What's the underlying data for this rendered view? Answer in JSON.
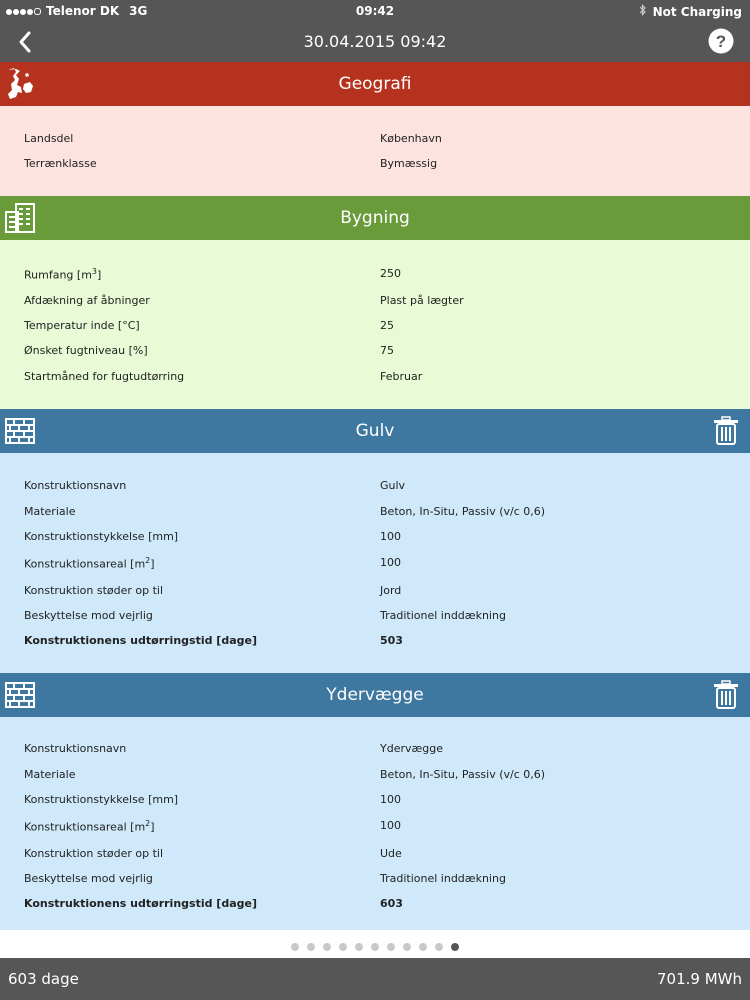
{
  "status_bar": {
    "carrier": "Telenor DK",
    "network": "3G",
    "time": "09:42",
    "battery": "Not Charging",
    "signal_bars": 4
  },
  "nav": {
    "title": "30.04.2015 09:42",
    "back_icon": "chevron-left-icon",
    "help_icon": "question-circle-icon"
  },
  "sections": [
    {
      "title": "Geografi",
      "icon": "denmark-map-icon",
      "color": "#b5321e",
      "bg": "#fde3e0",
      "rows": [
        {
          "label": "Landsdel",
          "value": "København"
        },
        {
          "label": "Terrænklasse",
          "value": "Bymæssig"
        }
      ]
    },
    {
      "title": "Bygning",
      "icon": "building-icon",
      "color": "#6a9b3a",
      "bg": "#e9fbd6",
      "rows": [
        {
          "label": "Rumfang [m",
          "sup": "3",
          "label_end": "]",
          "value": "250"
        },
        {
          "label": "Afdækning af åbninger",
          "value": "Plast på lægter"
        },
        {
          "label": "Temperatur inde [°C]",
          "value": "25"
        },
        {
          "label": "Ønsket fugtniveau [%]",
          "value": "75"
        },
        {
          "label": "Startmåned for fugtudtørring",
          "value": "Februar"
        }
      ]
    },
    {
      "title": "Gulv",
      "icon": "brick-wall-icon",
      "color": "#3e779f",
      "bg": "#cfe9fb",
      "rows": [
        {
          "label": "Konstruktionsnavn",
          "value": "Gulv"
        },
        {
          "label": "Materiale",
          "value": "Beton, In-Situ, Passiv (v/c 0,6)"
        },
        {
          "label": "Konstruktionstykkelse [mm]",
          "value": "100"
        },
        {
          "label": "Konstruktionsareal [m",
          "sup": "2",
          "label_end": "]",
          "value": "100"
        },
        {
          "label": "Konstruktion støder op til",
          "value": "Jord"
        },
        {
          "label": "Beskyttelse mod vejrlig",
          "value": "Traditionel inddækning"
        },
        {
          "label": "Konstruktionens udtørringstid [dage]",
          "value": "503",
          "bold": true
        }
      ]
    },
    {
      "title": "Ydervægge",
      "icon": "brick-wall-icon",
      "color": "#3e779f",
      "bg": "#cfe9fb",
      "rows": [
        {
          "label": "Konstruktionsnavn",
          "value": "Ydervægge"
        },
        {
          "label": "Materiale",
          "value": "Beton, In-Situ, Passiv (v/c 0,6)"
        },
        {
          "label": "Konstruktionstykkelse [mm]",
          "value": "100"
        },
        {
          "label": "Konstruktionsareal [m",
          "sup": "2",
          "label_end": "]",
          "value": "100"
        },
        {
          "label": "Konstruktion støder op til",
          "value": "Ude"
        },
        {
          "label": "Beskyttelse mod vejrlig",
          "value": "Traditionel inddækning"
        },
        {
          "label": "Konstruktionens udtørringstid [dage]",
          "value": "603",
          "bold": true
        }
      ]
    }
  ],
  "pager": {
    "count": 11,
    "active": 11
  },
  "footer": {
    "left": "603 dage",
    "right": "701.9 MWh"
  }
}
